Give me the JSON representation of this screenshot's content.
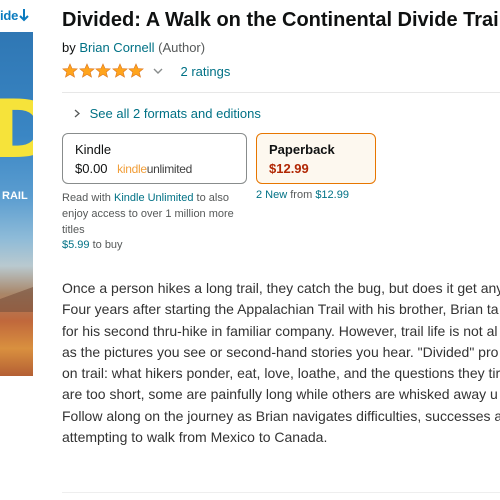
{
  "cover": {
    "look_inside_label": "ide",
    "look_inside_icon": "down-arrow-icon",
    "cover_letter": "D",
    "cover_text": "RAIL"
  },
  "product": {
    "title": "Divided: A Walk on the Continental Divide Trai",
    "author": "Brian Cornell",
    "author_role": "(Author)",
    "rating_stars": 5,
    "ratings_count_label": "2 ratings"
  },
  "formats": {
    "see_all_label": "See all 2 formats and editions",
    "kindle": {
      "name": "Kindle",
      "price": "$0.00",
      "ku_logo_part1": "kindle",
      "ku_logo_part2": "unlimited"
    },
    "paperback": {
      "name": "Paperback",
      "price": "$12.99"
    },
    "read_with_prefix": "Read with ",
    "read_with_link": "Kindle Unlimited",
    "read_with_suffix": " to also enjoy access to over 1 million more titles",
    "buy_price": "$5.99",
    "buy_suffix": " to buy",
    "new_count": "2 New",
    "new_from": " from ",
    "new_price": "$12.99"
  },
  "description": {
    "lines": [
      "Once a person hikes a long trail, they catch the bug, but does it get any",
      "Four years after starting the Appalachian Trail with his brother, Brian ta",
      "for his second thru-hike in familiar company. However, trail life is not al",
      "as the pictures you see or second-hand stories you hear. \"Divided\" pro",
      "on trail: what hikers ponder, eat, love, loathe, and the questions they tir",
      "are too short, some are painfully long while others are whisked away u",
      "Follow along on the journey as Brian navigates difficulties, successes a",
      "attempting to walk from Mexico to Canada."
    ]
  },
  "colors": {
    "link": "#007185",
    "star": "#ffa41c",
    "price_red": "#b12704",
    "selected_border": "#e77600"
  }
}
